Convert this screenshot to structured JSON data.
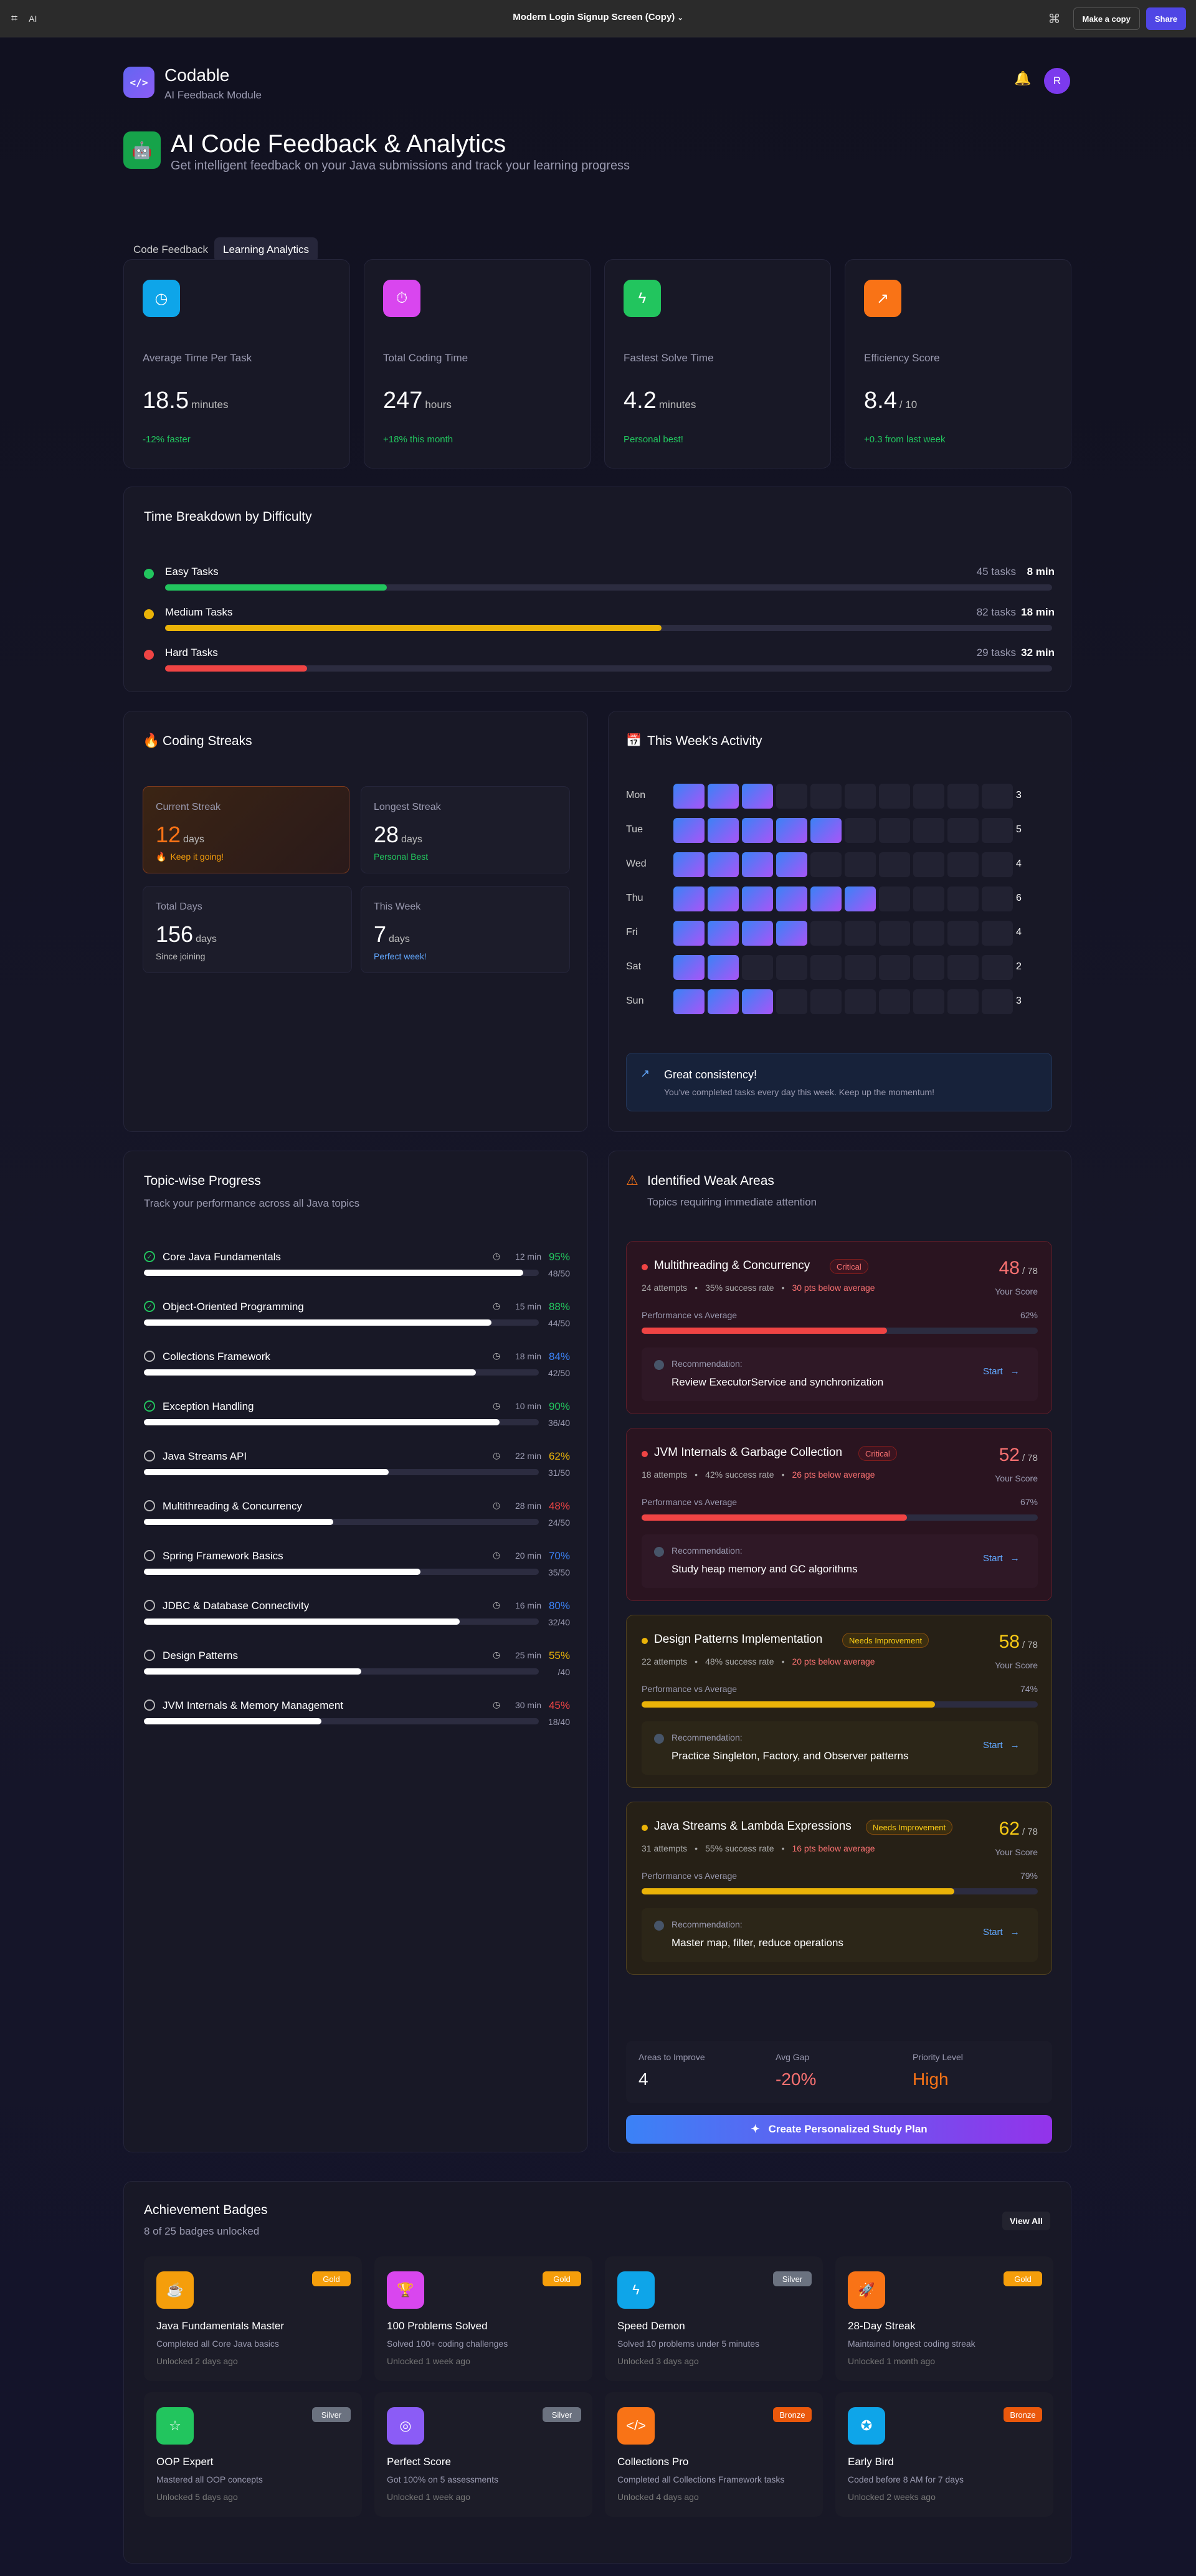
{
  "topbar": {
    "app": "AI",
    "title": "Modern Login Signup Screen (Copy)",
    "make_copy": "Make a copy",
    "share": "Share"
  },
  "brand": {
    "name": "Codable",
    "sub": "AI Feedback Module",
    "avatar": "R"
  },
  "hero": {
    "title": "AI Code Feedback & Analytics",
    "subtitle": "Get intelligent feedback on your Java submissions and track your learning progress"
  },
  "tabs": [
    {
      "label": "Code Feedback"
    },
    {
      "label": "Learning Analytics"
    }
  ],
  "stats": [
    {
      "label": "Average Time Per Task",
      "value": "18.5",
      "unit": "minutes",
      "note": "-12% faster",
      "color": "#0ea5e9",
      "icon": "clock-icon"
    },
    {
      "label": "Total Coding Time",
      "value": "247",
      "unit": "hours",
      "note": "+18% this month",
      "color": "#d946ef",
      "icon": "timer-icon"
    },
    {
      "label": "Fastest Solve Time",
      "value": "4.2",
      "unit": "minutes",
      "note": "Personal best!",
      "color": "#22c55e",
      "icon": "bolt-icon"
    },
    {
      "label": "Efficiency Score",
      "value": "8.4",
      "unit": "/ 10",
      "note": "+0.3 from last week",
      "color": "#f97316",
      "icon": "trend-icon"
    }
  ],
  "breakdown": {
    "title": "Time Breakdown by Difficulty",
    "rows": [
      {
        "label": "Easy Tasks",
        "tasks": "45 tasks",
        "time": "8 min",
        "color": "#22c55e",
        "fill": 0.25
      },
      {
        "label": "Medium Tasks",
        "tasks": "82 tasks",
        "time": "18 min",
        "color": "#eab308",
        "fill": 0.56
      },
      {
        "label": "Hard Tasks",
        "tasks": "29 tasks",
        "time": "32 min",
        "color": "#ef4444",
        "fill": 0.16
      }
    ]
  },
  "streaks": {
    "title": "Coding Streaks",
    "items": [
      {
        "label": "Current Streak",
        "value": "12",
        "unit": "days",
        "note": "Keep it going!"
      },
      {
        "label": "Longest Streak",
        "value": "28",
        "unit": "days",
        "note": "Personal Best"
      },
      {
        "label": "Total Days",
        "value": "156",
        "unit": "days",
        "note": "Since joining"
      },
      {
        "label": "This Week",
        "value": "7",
        "unit": "days",
        "note": "Perfect week!"
      }
    ]
  },
  "activity": {
    "title": "This Week's Activity",
    "days": [
      {
        "day": "Mon",
        "count": 3
      },
      {
        "day": "Tue",
        "count": 5
      },
      {
        "day": "Wed",
        "count": 4
      },
      {
        "day": "Thu",
        "count": 6
      },
      {
        "day": "Fri",
        "count": 4
      },
      {
        "day": "Sat",
        "count": 2
      },
      {
        "day": "Sun",
        "count": 3
      }
    ],
    "banner_title": "Great consistency!",
    "banner_text": "You've completed tasks every day this week. Keep up the momentum!"
  },
  "topics": {
    "title": "Topic-wise Progress",
    "subtitle": "Track your performance across all Java topics",
    "items": [
      {
        "name": "Core Java Fundamentals",
        "time": "12 min",
        "pct": "95%",
        "done": "48/50",
        "fill": 0.96,
        "color": "#22c55e",
        "check": true
      },
      {
        "name": "Object-Oriented Programming",
        "time": "15 min",
        "pct": "88%",
        "done": "44/50",
        "fill": 0.88,
        "color": "#22c55e",
        "check": true
      },
      {
        "name": "Collections Framework",
        "time": "18 min",
        "pct": "84%",
        "done": "42/50",
        "fill": 0.84,
        "color": "#3b82f6",
        "check": false
      },
      {
        "name": "Exception Handling",
        "time": "10 min",
        "pct": "90%",
        "done": "36/40",
        "fill": 0.9,
        "color": "#22c55e",
        "check": true
      },
      {
        "name": "Java Streams API",
        "time": "22 min",
        "pct": "62%",
        "done": "31/50",
        "fill": 0.62,
        "color": "#eab308",
        "check": false
      },
      {
        "name": "Multithreading & Concurrency",
        "time": "28 min",
        "pct": "48%",
        "done": "24/50",
        "fill": 0.48,
        "color": "#ef4444",
        "check": false
      },
      {
        "name": "Spring Framework Basics",
        "time": "20 min",
        "pct": "70%",
        "done": "35/50",
        "fill": 0.7,
        "color": "#3b82f6",
        "check": false
      },
      {
        "name": "JDBC & Database Connectivity",
        "time": "16 min",
        "pct": "80%",
        "done": "32/40",
        "fill": 0.8,
        "color": "#3b82f6",
        "check": false
      },
      {
        "name": "Design Patterns",
        "time": "25 min",
        "pct": "55%",
        "done": "/40",
        "fill": 0.55,
        "color": "#eab308",
        "check": false
      },
      {
        "name": "JVM Internals & Memory Management",
        "time": "30 min",
        "pct": "45%",
        "done": "18/40",
        "fill": 0.45,
        "color": "#ef4444",
        "check": false
      }
    ]
  },
  "weak": {
    "title": "Identified Weak Areas",
    "subtitle": "Topics requiring immediate attention",
    "items": [
      {
        "name": "Multithreading & Concurrency",
        "badge": "Critical",
        "attempts": "24 attempts",
        "rate": "35% success rate",
        "gap": "30 pts below average",
        "score": "48",
        "max": "/ 78",
        "score_label": "Your Score",
        "perf_label": "Performance vs Average",
        "perf": "62%",
        "fill": 0.62,
        "rec_label": "Recommendation:",
        "rec": "Review ExecutorService and synchronization",
        "start": "Start",
        "tone": "red"
      },
      {
        "name": "JVM Internals & Garbage Collection",
        "badge": "Critical",
        "attempts": "18 attempts",
        "rate": "42% success rate",
        "gap": "26 pts below average",
        "score": "52",
        "max": "/ 78",
        "score_label": "Your Score",
        "perf_label": "Performance vs Average",
        "perf": "67%",
        "fill": 0.67,
        "rec_label": "Recommendation:",
        "rec": "Study heap memory and GC algorithms",
        "start": "Start",
        "tone": "red"
      },
      {
        "name": "Design Patterns Implementation",
        "badge": "Needs Improvement",
        "attempts": "22 attempts",
        "rate": "48% success rate",
        "gap": "20 pts below average",
        "score": "58",
        "max": "/ 78",
        "score_label": "Your Score",
        "perf_label": "Performance vs Average",
        "perf": "74%",
        "fill": 0.74,
        "rec_label": "Recommendation:",
        "rec": "Practice Singleton, Factory, and Observer patterns",
        "start": "Start",
        "tone": "yellow"
      },
      {
        "name": "Java Streams & Lambda Expressions",
        "badge": "Needs Improvement",
        "attempts": "31 attempts",
        "rate": "55% success rate",
        "gap": "16 pts below average",
        "score": "62",
        "max": "/ 78",
        "score_label": "Your Score",
        "perf_label": "Performance vs Average",
        "perf": "79%",
        "fill": 0.79,
        "rec_label": "Recommendation:",
        "rec": "Master map, filter, reduce operations",
        "start": "Start",
        "tone": "yellow"
      }
    ],
    "summary": [
      {
        "label": "Areas to Improve",
        "value": "4"
      },
      {
        "label": "Avg Gap",
        "value": "-20%"
      },
      {
        "label": "Priority Level",
        "value": "High"
      }
    ],
    "plan_button": "Create Personalized Study Plan"
  },
  "badges": {
    "title": "Achievement Badges",
    "subtitle": "8 of 25 badges unlocked",
    "view_all": "View All",
    "items": [
      {
        "name": "Java Fundamentals Master",
        "desc": "Completed all Core Java basics",
        "when": "Unlocked 2 days ago",
        "tier": "Gold",
        "color": "#f59e0b",
        "icon": "coffee-icon"
      },
      {
        "name": "100 Problems Solved",
        "desc": "Solved 100+ coding challenges",
        "when": "Unlocked 1 week ago",
        "tier": "Gold",
        "color": "#d946ef",
        "icon": "trophy-icon"
      },
      {
        "name": "Speed Demon",
        "desc": "Solved 10 problems under 5 minutes",
        "when": "Unlocked 3 days ago",
        "tier": "Silver",
        "color": "#0ea5e9",
        "icon": "bolt-icon"
      },
      {
        "name": "28-Day Streak",
        "desc": "Maintained longest coding streak",
        "when": "Unlocked 1 month ago",
        "tier": "Gold",
        "color": "#f97316",
        "icon": "rocket-icon"
      },
      {
        "name": "OOP Expert",
        "desc": "Mastered all OOP concepts",
        "when": "Unlocked 5 days ago",
        "tier": "Silver",
        "color": "#22c55e",
        "icon": "star-icon"
      },
      {
        "name": "Perfect Score",
        "desc": "Got 100% on 5 assessments",
        "when": "Unlocked 1 week ago",
        "tier": "Silver",
        "color": "#8b5cf6",
        "icon": "target-icon"
      },
      {
        "name": "Collections Pro",
        "desc": "Completed all Collections Framework tasks",
        "when": "Unlocked 4 days ago",
        "tier": "Bronze",
        "color": "#f97316",
        "icon": "code-icon"
      },
      {
        "name": "Early Bird",
        "desc": "Coded before 8 AM for 7 days",
        "when": "Unlocked 2 weeks ago",
        "tier": "Bronze",
        "color": "#0ea5e9",
        "icon": "award-icon"
      }
    ]
  }
}
